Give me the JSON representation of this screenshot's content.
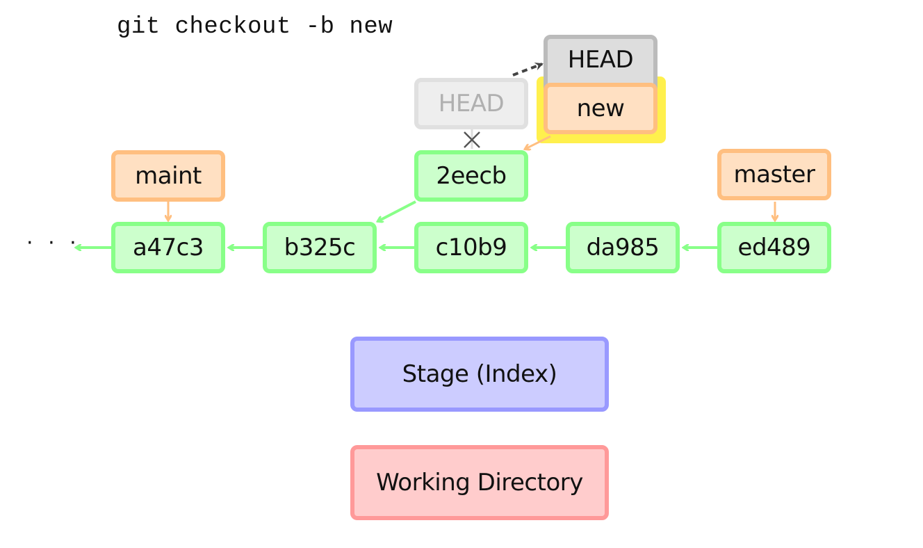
{
  "command": "git checkout -b new",
  "commits": [
    {
      "id": "a47c3"
    },
    {
      "id": "b325c"
    },
    {
      "id": "c10b9"
    },
    {
      "id": "da985"
    },
    {
      "id": "ed489"
    },
    {
      "id": "2eecb"
    }
  ],
  "branches": {
    "maint": {
      "label": "maint",
      "target": "a47c3"
    },
    "master": {
      "label": "master",
      "target": "ed489"
    },
    "new": {
      "label": "new",
      "target": "2eecb",
      "highlighted": true
    }
  },
  "head": {
    "label": "HEAD",
    "target": "new"
  },
  "head_old": {
    "label": "HEAD",
    "target": "2eecb",
    "detached": true
  },
  "ellipsis": "· · ·",
  "stage": {
    "label": "Stage (Index)"
  },
  "working_directory": {
    "label": "Working Directory"
  },
  "colors": {
    "commit_fill": "#ccffcc",
    "commit_border": "#88ff88",
    "branch_fill": "#ffe0c2",
    "branch_border": "#ffbf80",
    "head_fill": "#dddddd",
    "head_border": "#bbbbbb",
    "stage_fill": "#ccccff",
    "stage_border": "#9999ff",
    "wd_fill": "#ffcccc",
    "wd_border": "#ff9999",
    "highlight": "#fff04d"
  }
}
